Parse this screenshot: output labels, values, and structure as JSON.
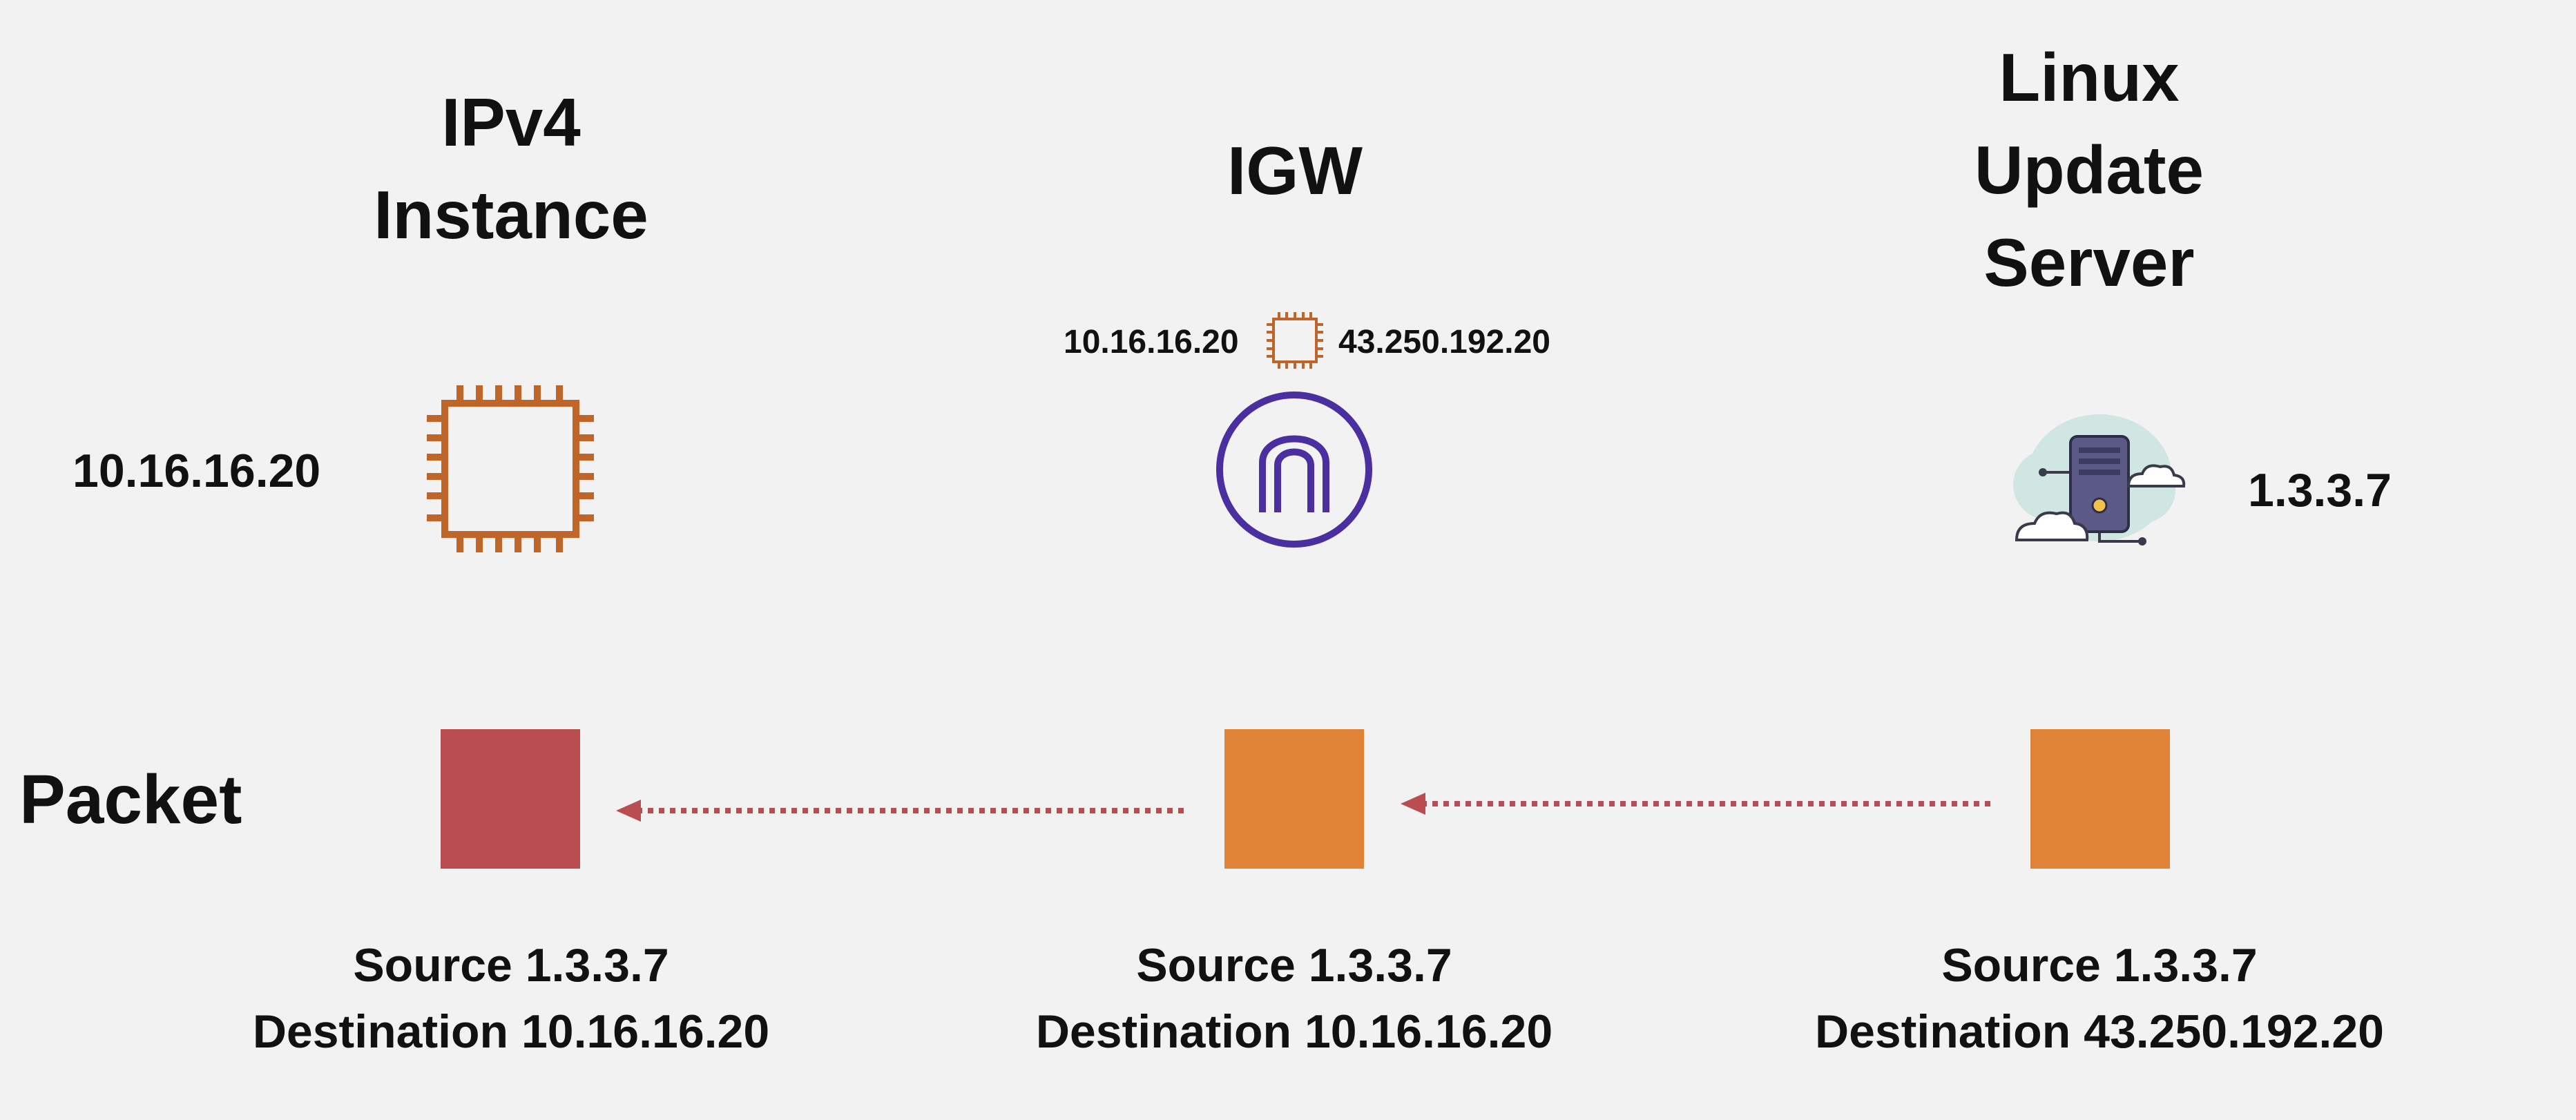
{
  "columns": {
    "left": {
      "heading_lines": [
        "IPv4",
        "Instance"
      ],
      "ip": "10.16.16.20",
      "icon": "chip-icon",
      "packet_color": "#b94d4f",
      "packet_source": "Source  1.3.3.7",
      "packet_destination": "Destination 10.16.16.20"
    },
    "middle": {
      "heading_lines": [
        "IGW"
      ],
      "mapping_private_ip": "10.16.16.20",
      "mapping_public_ip": "43.250.192.20",
      "mapping_icon": "chip-icon",
      "icon": "internet-gateway-icon",
      "packet_color": "#e08336",
      "packet_source": "Source 1.3.3.7",
      "packet_destination": "Destination 10.16.16.20"
    },
    "right": {
      "heading_lines": [
        "Linux",
        "Update",
        "Server"
      ],
      "ip": "1.3.3.7",
      "icon": "cloud-server-icon",
      "packet_color": "#e08336",
      "packet_source": "Source 1.3.3.7",
      "packet_destination": "Destination 43.250.192.20"
    }
  },
  "row_label": "Packet",
  "colors": {
    "background": "#f3f2f2",
    "chip": "#c0652a",
    "gateway": "#4b2fa0",
    "arrow": "#b94d4f"
  }
}
